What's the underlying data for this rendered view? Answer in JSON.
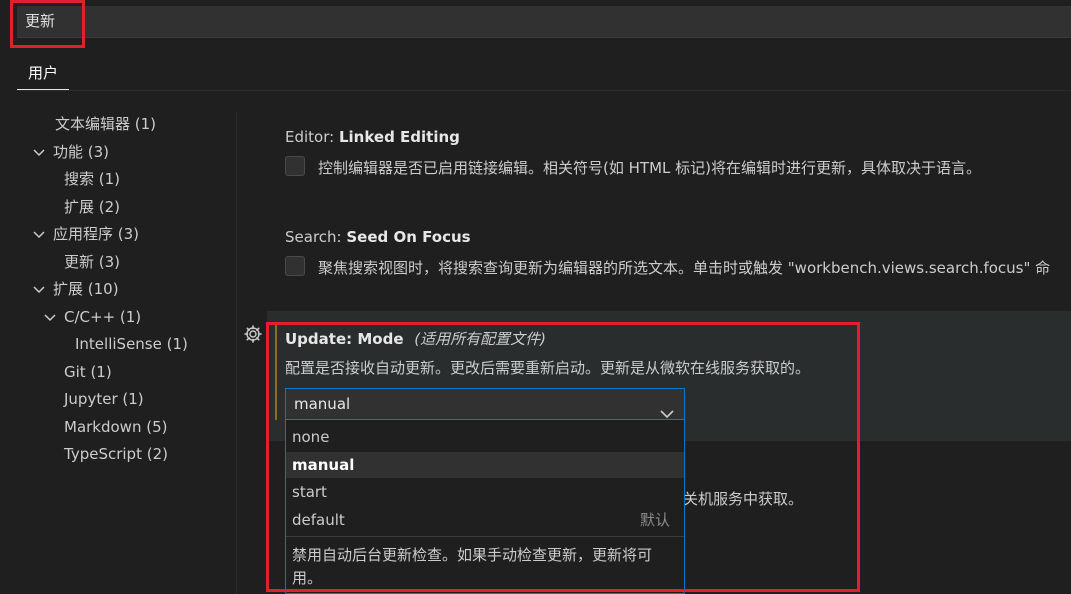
{
  "search": {
    "value": "更新"
  },
  "tabs": [
    {
      "label": "用户"
    }
  ],
  "toc": [
    {
      "label": "文本编辑器 (1)"
    },
    {
      "label": "功能 (3)"
    },
    {
      "label": "搜索 (1)"
    },
    {
      "label": "扩展 (2)"
    },
    {
      "label": "应用程序 (3)"
    },
    {
      "label": "更新 (3)"
    },
    {
      "label": "扩展 (10)"
    },
    {
      "label": "C/C++ (1)"
    },
    {
      "label": "IntelliSense (1)"
    },
    {
      "label": "Git (1)"
    },
    {
      "label": "Jupyter (1)"
    },
    {
      "label": "Markdown (5)"
    },
    {
      "label": "TypeScript (2)"
    }
  ],
  "settings": {
    "linked_editing": {
      "category": "Editor: ",
      "name": "Linked Editing",
      "description": "控制编辑器是否已启用链接编辑。相关符号(如 HTML 标记)将在编辑时进行更新，具体取决于语言。"
    },
    "seed_on_focus": {
      "category": "Search: ",
      "name": "Seed On Focus",
      "description": "聚焦搜索视图时，将搜索查询更新为编辑器的所选文本。单击时或触发 \"workbench.views.search.focus\" 命"
    },
    "update_mode": {
      "category": "Update: ",
      "name": "Mode",
      "scope": "(适用所有配置文件)",
      "description": "配置是否接收自动更新。更改后需要重新启动。更新是从微软在线服务获取的。",
      "selected": "manual",
      "options": [
        {
          "label": "none",
          "hint": ""
        },
        {
          "label": "manual",
          "hint": ""
        },
        {
          "label": "start",
          "hint": ""
        },
        {
          "label": "default",
          "hint": "默认"
        }
      ],
      "option_description": "禁用自动后台更新检查。如果手动检查更新，更新将可用。"
    },
    "partial_next_description": "关机服务中获取。"
  },
  "colors": {
    "background": "#1f1f1f",
    "focus_border": "#0078d4",
    "annotation_red": "#e02030",
    "modified_indicator": "#8a6d21"
  }
}
